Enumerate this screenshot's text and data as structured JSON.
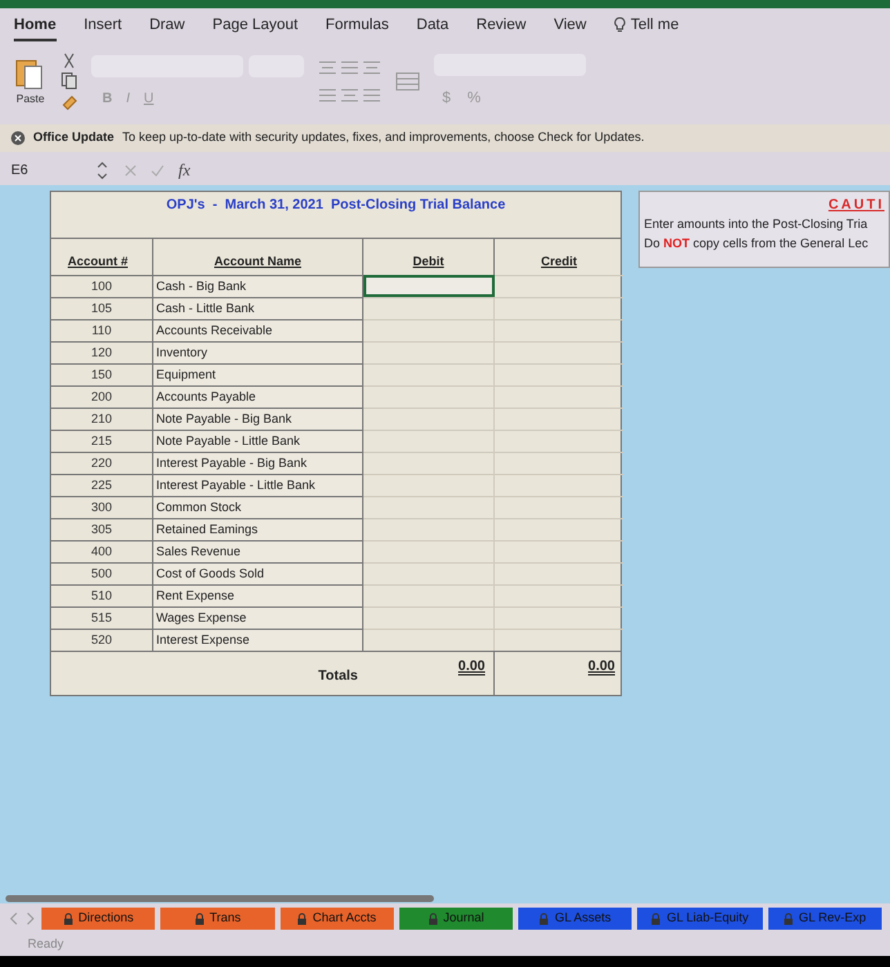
{
  "ribbon": {
    "tabs": [
      {
        "label": "Home",
        "selected": true
      },
      {
        "label": "Insert",
        "selected": false
      },
      {
        "label": "Draw",
        "selected": false
      },
      {
        "label": "Page Layout",
        "selected": false
      },
      {
        "label": "Formulas",
        "selected": false
      },
      {
        "label": "Data",
        "selected": false
      },
      {
        "label": "Review",
        "selected": false
      },
      {
        "label": "View",
        "selected": false
      }
    ],
    "tell_me": "Tell me",
    "paste": "Paste",
    "font_buttons": [
      "B",
      "I",
      "U"
    ],
    "number_buttons": [
      "$",
      "%"
    ]
  },
  "update_bar": {
    "title": "Office Update",
    "message": "To keep up-to-date with security updates, fixes, and improvements, choose Check for Updates."
  },
  "formula_bar": {
    "cell_ref": "E6",
    "function_label": "fx"
  },
  "sheet": {
    "title": "OPJ's  -  March 31, 2021  Post-Closing Trial Balance",
    "columns": [
      "Account #",
      "Account Name",
      "Debit",
      "Credit"
    ],
    "rows": [
      {
        "account": "100",
        "name": "Cash - Big Bank",
        "selected": true
      },
      {
        "account": "105",
        "name": "Cash - Little Bank",
        "selected": false
      },
      {
        "account": "110",
        "name": "Accounts Receivable",
        "selected": false
      },
      {
        "account": "120",
        "name": "Inventory",
        "selected": false
      },
      {
        "account": "150",
        "name": "Equipment",
        "selected": false
      },
      {
        "account": "200",
        "name": "Accounts Payable",
        "selected": false
      },
      {
        "account": "210",
        "name": "Note Payable - Big Bank",
        "selected": false
      },
      {
        "account": "215",
        "name": "Note Payable - Little Bank",
        "selected": false
      },
      {
        "account": "220",
        "name": "Interest Payable - Big Bank",
        "selected": false
      },
      {
        "account": "225",
        "name": "Interest Payable - Little Bank",
        "selected": false
      },
      {
        "account": "300",
        "name": "Common Stock",
        "selected": false
      },
      {
        "account": "305",
        "name": "Retained Eamings",
        "selected": false
      },
      {
        "account": "400",
        "name": "Sales Revenue",
        "selected": false
      },
      {
        "account": "500",
        "name": "Cost of Goods Sold",
        "selected": false
      },
      {
        "account": "510",
        "name": "Rent Expense",
        "selected": false
      },
      {
        "account": "515",
        "name": "Wages Expense",
        "selected": false
      },
      {
        "account": "520",
        "name": "Interest Expense",
        "selected": false
      }
    ],
    "totals": {
      "label": "Totals",
      "debit": "0.00",
      "credit": "0.00"
    }
  },
  "caution": {
    "title": "CAUTI",
    "lines": [
      "Enter amounts into the Post-Closing Tria",
      "Do **NOT** copy cells from the General Lec"
    ]
  },
  "sheet_tabs": [
    {
      "label": "Directions",
      "color": "#e8632a"
    },
    {
      "label": "Trans",
      "color": "#e8632a"
    },
    {
      "label": "Chart Accts",
      "color": "#e8632a"
    },
    {
      "label": "Journal",
      "color": "#1f8a2e"
    },
    {
      "label": "GL Assets",
      "color": "#1d4fe0"
    },
    {
      "label": "GL Liab-Equity",
      "color": "#1d4fe0"
    },
    {
      "label": "GL Rev-Exp",
      "color": "#1d4fe0"
    }
  ],
  "status": "Ready"
}
